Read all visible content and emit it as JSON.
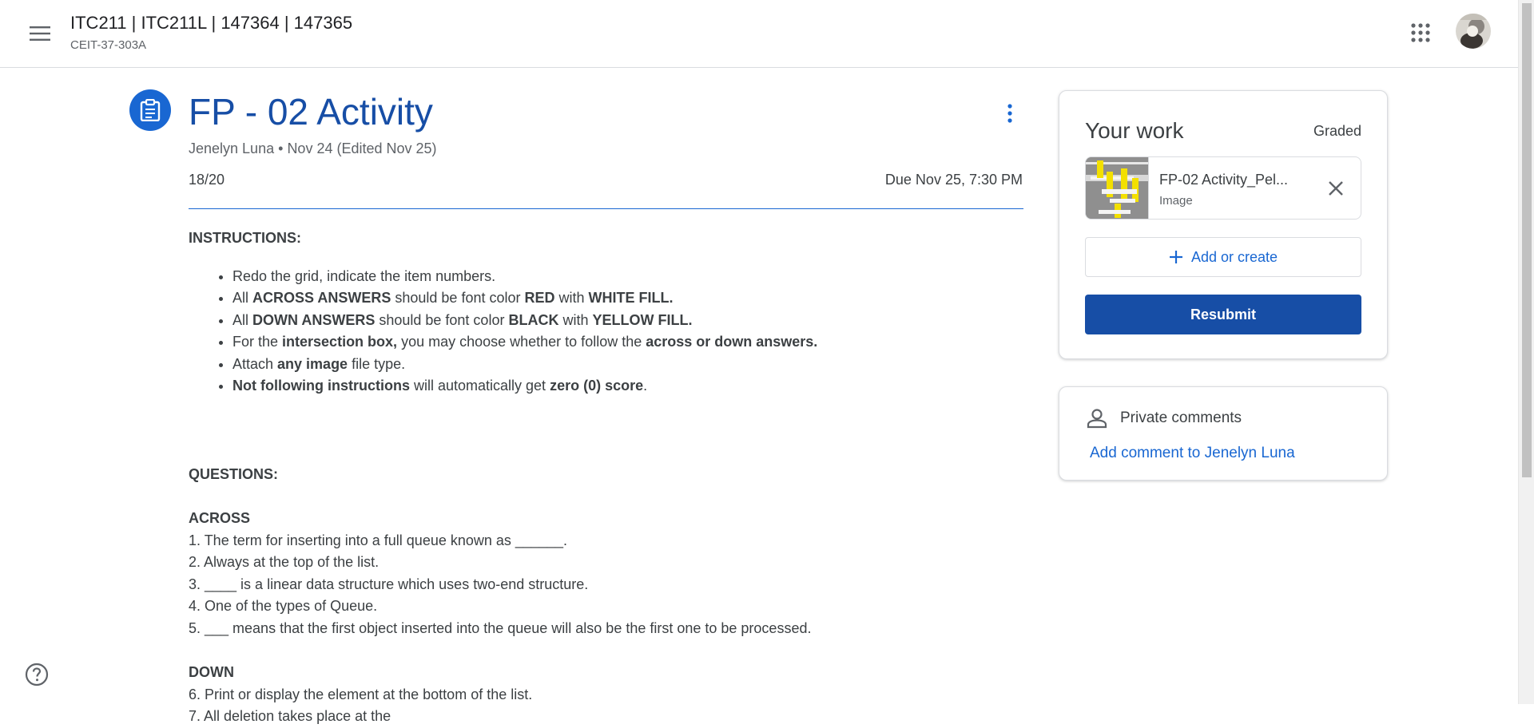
{
  "header": {
    "class_title": "ITC211 | ITC211L | 147364 | 147365",
    "class_section": "CEIT-37-303A",
    "menu_icon": "hamburger-menu-icon",
    "apps_icon": "google-apps-grid-icon",
    "avatar_icon": "user-avatar"
  },
  "assignment": {
    "title": "FP - 02 Activity",
    "author": "Jenelyn Luna",
    "separator": "•",
    "posted": "Nov 24 (Edited Nov 25)",
    "score": "18/20",
    "due": "Due Nov 25, 7:30 PM",
    "icon": "assignment-clipboard-icon",
    "more_icon": "more-vertical-icon"
  },
  "instructions": {
    "heading": "INSTRUCTIONS:",
    "item1": "Redo the grid, indicate the item numbers.",
    "item2_a": "All ",
    "item2_b": "ACROSS ANSWERS",
    "item2_c": " should be font color ",
    "item2_d": "RED",
    "item2_e": " with ",
    "item2_f": "WHITE FILL.",
    "item3_a": "All ",
    "item3_b": "DOWN ANSWERS",
    "item3_c": " should be font color ",
    "item3_d": "BLACK",
    "item3_e": " with ",
    "item3_f": "YELLOW FILL.",
    "item4_a": "For the ",
    "item4_b": "intersection box,",
    "item4_c": " you may choose whether to follow the ",
    "item4_d": "across or down answers.",
    "item5_a": "Attach ",
    "item5_b": "any image",
    "item5_c": " file type.",
    "item6_a": "Not following instructions",
    "item6_b": " will automatically get ",
    "item6_c": "zero (0) score",
    "item6_d": "."
  },
  "questions": {
    "heading": "QUESTIONS:",
    "across_heading": "ACROSS",
    "across": [
      "1. The term for inserting into a full queue known as ______.",
      "2. Always at the top of the list.",
      "3. ____ is a linear data structure which uses two-end structure.",
      "4. One of the types of Queue.",
      "5. ___ means that the first object inserted into the queue will also be the first one to be processed."
    ],
    "down_heading": "DOWN",
    "down": [
      "6. Print or display the element at the bottom of the list.",
      "7. All deletion takes place at the"
    ]
  },
  "your_work": {
    "title": "Your work",
    "status": "Graded",
    "attachment_name": "FP-02 Activity_Pel...",
    "attachment_type": "Image",
    "remove_icon": "close-icon",
    "add_icon": "plus-icon",
    "add_label": "Add or create",
    "resubmit_label": "Resubmit"
  },
  "private_comments": {
    "icon": "person-outline-icon",
    "title": "Private comments",
    "link": "Add comment to Jenelyn Luna"
  },
  "help": {
    "icon": "help-circle-icon"
  },
  "colors": {
    "accent_blue": "#1967d2",
    "title_blue": "#174ea6",
    "text": "#3c4043",
    "muted": "#5f6368",
    "border": "#dadce0"
  }
}
